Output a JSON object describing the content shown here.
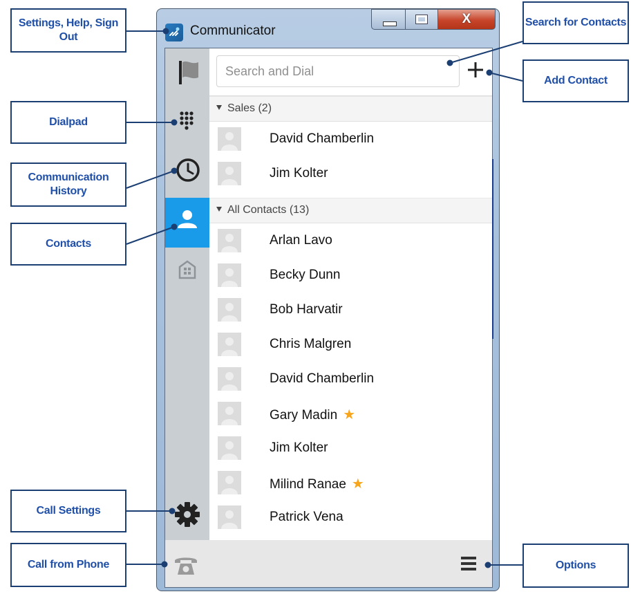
{
  "window": {
    "title": "Communicator",
    "controls": {
      "minimize": "minimize-icon",
      "maximize": "maximize-icon",
      "close": "X"
    }
  },
  "search": {
    "placeholder": "Search and Dial",
    "add_label": "+"
  },
  "groups": [
    {
      "label": "Sales (2)",
      "contacts": [
        {
          "name": "David Chamberlin",
          "favorite": false
        },
        {
          "name": "Jim Kolter",
          "favorite": false
        }
      ]
    },
    {
      "label": "All Contacts (13)",
      "contacts": [
        {
          "name": "Arlan Lavo",
          "favorite": false
        },
        {
          "name": "Becky Dunn",
          "favorite": false
        },
        {
          "name": "Bob Harvatir",
          "favorite": false
        },
        {
          "name": "Chris Malgren",
          "favorite": false
        },
        {
          "name": "David Chamberlin",
          "favorite": false
        },
        {
          "name": "Gary Madin",
          "favorite": true
        },
        {
          "name": "Jim Kolter",
          "favorite": false
        },
        {
          "name": "Milind Ranae",
          "favorite": true
        },
        {
          "name": "Patrick Vena",
          "favorite": false
        }
      ]
    }
  ],
  "sidebar": [
    {
      "icon": "flag-icon",
      "active": false
    },
    {
      "icon": "dialpad-icon",
      "active": false
    },
    {
      "icon": "clock-icon",
      "active": false
    },
    {
      "icon": "contacts-icon",
      "active": true
    },
    {
      "icon": "building-icon",
      "active": false
    },
    {
      "icon": "gear-icon",
      "active": false
    }
  ],
  "callouts": {
    "settings": "Settings, Help, Sign Out",
    "dialpad": "Dialpad",
    "history": "Communication History",
    "contacts": "Contacts",
    "call_settings": "Call Settings",
    "call_from_phone": "Call from Phone",
    "search": "Search for Contacts",
    "add_contact": "Add Contact",
    "options": "Options"
  },
  "colors": {
    "accent": "#1a9be9",
    "callout_text": "#1f4fa8",
    "callout_border": "#1c3f73",
    "star": "#f7a51c"
  }
}
